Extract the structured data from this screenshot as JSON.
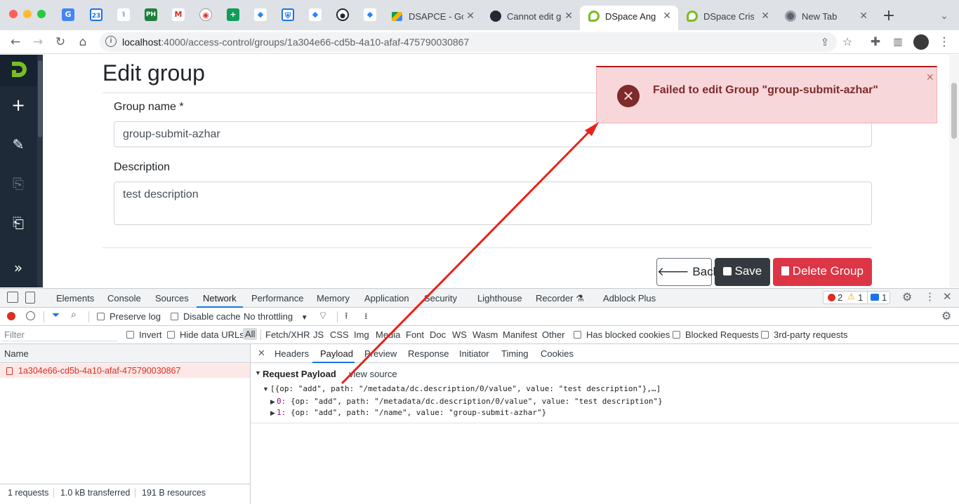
{
  "browser": {
    "tabs": [
      {
        "title": "DSAPCE - Go",
        "active": false
      },
      {
        "title": "Cannot edit g",
        "active": false
      },
      {
        "title": "DSpace Angu",
        "active": true
      },
      {
        "title": "DSpace Cris",
        "active": false
      },
      {
        "title": "New Tab",
        "active": false
      }
    ],
    "pinned_labels": {
      "ph": "PH",
      "m": "M",
      "sheets": "+",
      "jira": "◆"
    },
    "new_tab": "+",
    "url_host": "localhost",
    "url_rest": ":4000/access-control/groups/1a304e66-cd5b-4a10-afaf-475790030867"
  },
  "page": {
    "title": "Edit group",
    "group_name_label": "Group name *",
    "group_name_value": "group-submit-azhar",
    "description_label": "Description",
    "description_value": "test description",
    "back_label": "Back",
    "save_label": "Save",
    "delete_label": "Delete Group"
  },
  "toast": {
    "message": "Failed to edit Group \"group-submit-azhar\"",
    "close": "×"
  },
  "devtools": {
    "tabs": [
      "Elements",
      "Console",
      "Sources",
      "Network",
      "Performance",
      "Memory",
      "Application",
      "Security",
      "Lighthouse",
      "Recorder",
      "Adblock Plus"
    ],
    "active_tab": "Network",
    "errors": "2",
    "warnings": "1",
    "messages": "1",
    "controls": {
      "preserve_log": "Preserve log",
      "disable_cache": "Disable cache",
      "throttling": "No throttling"
    },
    "filter": {
      "placeholder": "Filter",
      "invert": "Invert",
      "hide_data_urls": "Hide data URLs",
      "types": [
        "All",
        "Fetch/XHR",
        "JS",
        "CSS",
        "Img",
        "Media",
        "Font",
        "Doc",
        "WS",
        "Wasm",
        "Manifest",
        "Other"
      ],
      "has_blocked_cookies": "Has blocked cookies",
      "blocked_requests": "Blocked Requests",
      "third_party": "3rd-party requests"
    },
    "request_list": {
      "header": "Name",
      "rows": [
        "1a304e66-cd5b-4a10-afaf-475790030867"
      ]
    },
    "status_bar": {
      "requests": "1 requests",
      "transferred": "1.0 kB transferred",
      "resources": "191 B resources"
    },
    "detail_tabs": [
      "Headers",
      "Payload",
      "Preview",
      "Response",
      "Initiator",
      "Timing",
      "Cookies"
    ],
    "active_detail_tab": "Payload",
    "payload": {
      "section_title": "Request Payload",
      "view_source": "view source",
      "summary": "[{op: \"add\", path: \"/metadata/dc.description/0/value\", value: \"test description\"},…]",
      "items": [
        {
          "key": "0:",
          "value": "{op: \"add\", path: \"/metadata/dc.description/0/value\", value: \"test description\"}"
        },
        {
          "key": "1:",
          "value": "{op: \"add\", path: \"/name\", value: \"group-submit-azhar\"}"
        }
      ]
    }
  },
  "colors": {
    "accent": "#1a73e8",
    "danger": "#dc3545",
    "secondary": "#343a40",
    "toast_bg": "#f8d7da",
    "annotation_arrow": "#e8231b"
  }
}
